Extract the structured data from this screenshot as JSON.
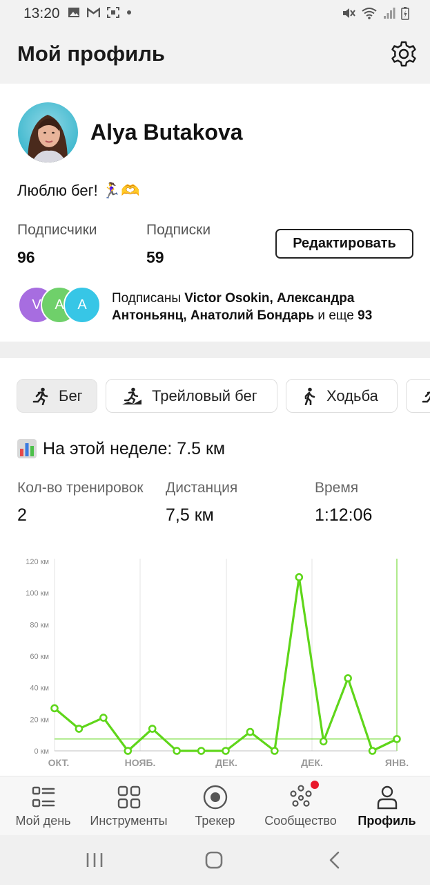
{
  "status_bar": {
    "time": "13:20"
  },
  "header": {
    "title": "Мой профиль"
  },
  "profile": {
    "name": "Alya Butakova",
    "bio": "Люблю бег! 🏃‍♀️🫶",
    "followers_label": "Подписчики",
    "followers_count": "96",
    "following_label": "Подписки",
    "following_count": "59",
    "edit_label": "Редактировать",
    "follower_avatars": [
      {
        "letter": "V",
        "color": "#a76de0"
      },
      {
        "letter": "A",
        "color": "#6fd06a"
      },
      {
        "letter": "A",
        "color": "#37c6e6"
      }
    ],
    "followed_prefix": "Подписаны",
    "followed_names": "Victor Osokin, Александра Антоньянц, Анатолий Бондарь",
    "followed_and_more": "и еще",
    "followed_more_count": "93"
  },
  "tabs": [
    {
      "label": "Бег",
      "icon": "running-icon",
      "active": true
    },
    {
      "label": "Трейловый бег",
      "icon": "trail-running-icon",
      "active": false
    },
    {
      "label": "Ходьба",
      "icon": "walking-icon",
      "active": false
    },
    {
      "label": "",
      "icon": "running-icon",
      "active": false
    }
  ],
  "week": {
    "title": "На этой неделе: 7.5 км",
    "icon": "bar-chart-icon",
    "metrics": [
      {
        "label": "Кол-во тренировок",
        "value": "2"
      },
      {
        "label": "Дистанция",
        "value": "7,5 км"
      },
      {
        "label": "Время",
        "value": "1:12:06"
      }
    ]
  },
  "chart_data": {
    "type": "line",
    "title": "",
    "xlabel": "",
    "ylabel": "",
    "ylim": [
      0,
      120
    ],
    "y_ticks": [
      "0 км",
      "20 км",
      "40 км",
      "60 км",
      "80 км",
      "100 км",
      "120 км"
    ],
    "x_tick_labels": [
      "ОКТ.",
      "НОЯБ.",
      "ДЕК.",
      "ДЕК.",
      "ЯНВ."
    ],
    "series": [
      {
        "values": [
          27,
          14,
          21,
          0,
          14,
          0,
          0,
          0,
          12,
          0,
          110,
          6,
          46,
          0,
          7.5
        ]
      }
    ],
    "reference_line": 7.5,
    "line_color": "#5fd61a",
    "grid": "vertical"
  },
  "bottom_nav": [
    {
      "label": "Мой день",
      "icon": "my-day-icon",
      "active": false
    },
    {
      "label": "Инструменты",
      "icon": "tools-grid-icon",
      "active": false
    },
    {
      "label": "Трекер",
      "icon": "tracker-record-icon",
      "active": false
    },
    {
      "label": "Сообщество",
      "icon": "community-icon",
      "active": false,
      "badge": true
    },
    {
      "label": "Профиль",
      "icon": "profile-icon",
      "active": true
    }
  ],
  "colors": {
    "accent": "#5fd61a",
    "badge": "#e8192c"
  }
}
